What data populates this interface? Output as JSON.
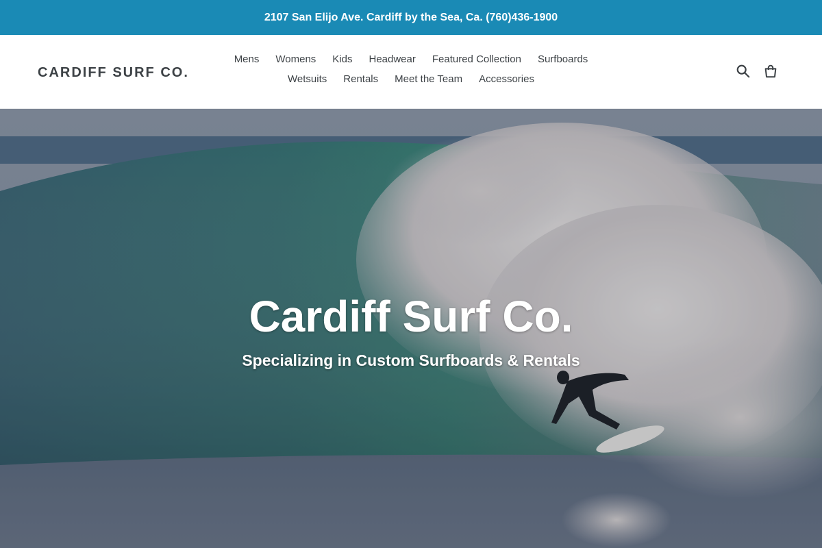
{
  "announcement": {
    "text": "2107 San Elijo Ave. Cardiff by the Sea, Ca. (760)436-1900"
  },
  "header": {
    "logo": "CARDIFF SURF CO.",
    "nav_row_1": [
      "Mens",
      "Womens",
      "Kids",
      "Headwear",
      "Featured Collection",
      "Surfboards"
    ],
    "nav_row_2": [
      "Wetsuits",
      "Rentals",
      "Meet the Team",
      "Accessories"
    ],
    "icons": [
      "search-icon",
      "cart-icon"
    ]
  },
  "hero": {
    "title": "Cardiff Surf Co.",
    "subtitle": "Specializing in Custom Surfboards & Rentals"
  },
  "colors": {
    "announcement_bg": "#1a8ab5",
    "text": "#3d4246",
    "white": "#ffffff"
  }
}
